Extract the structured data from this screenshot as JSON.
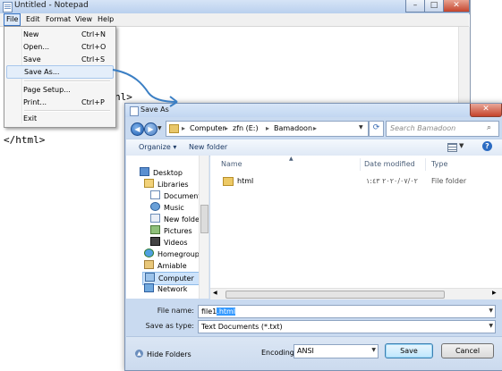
{
  "notepad": {
    "title": "Untitled - Notepad",
    "menu": [
      "File",
      "Edit",
      "Format",
      "View",
      "Help"
    ],
    "content_fragment": "nl>",
    "content_last_line": "</html>",
    "file_menu": [
      {
        "label": "New",
        "shortcut": "Ctrl+N"
      },
      {
        "label": "Open...",
        "shortcut": "Ctrl+O"
      },
      {
        "label": "Save",
        "shortcut": "Ctrl+S"
      },
      {
        "label": "Save As...",
        "shortcut": ""
      },
      {
        "label": "Page Setup...",
        "shortcut": ""
      },
      {
        "label": "Print...",
        "shortcut": "Ctrl+P"
      },
      {
        "label": "Exit",
        "shortcut": ""
      }
    ],
    "highlighted_item": "Save As..."
  },
  "dialog": {
    "title": "Save As",
    "breadcrumb": [
      "Computer",
      "zfn (E:)",
      "Bamadoon"
    ],
    "search_placeholder": "Search Bamadoon",
    "toolbar": {
      "organize": "Organize ▾",
      "new_folder": "New folder"
    },
    "nav_items": [
      "Desktop",
      "Libraries",
      "Documents",
      "Music",
      "New folder",
      "Pictures",
      "Videos",
      "Homegroup",
      "Amiable",
      "Computer",
      "Network"
    ],
    "selected_nav": "Computer",
    "columns": [
      "Name",
      "Date modified",
      "Type"
    ],
    "files": [
      {
        "name": "html",
        "date": "٢٠٢٠/٠٧/٠٢ ١:٤٣",
        "type": "File folder"
      }
    ],
    "file_name_label": "File name:",
    "file_name_value": "file1.html",
    "save_as_type_label": "Save as type:",
    "save_as_type_value": "Text Documents (*.txt)",
    "encoding_label": "Encoding:",
    "encoding_value": "ANSI",
    "hide_folders": "Hide Folders",
    "save_button": "Save",
    "cancel_button": "Cancel"
  },
  "colors": {
    "title_bar": "#c2d6f1",
    "selection": "#3399ff",
    "close_button": "#c5432b",
    "arrow": "#3b7fc4"
  }
}
